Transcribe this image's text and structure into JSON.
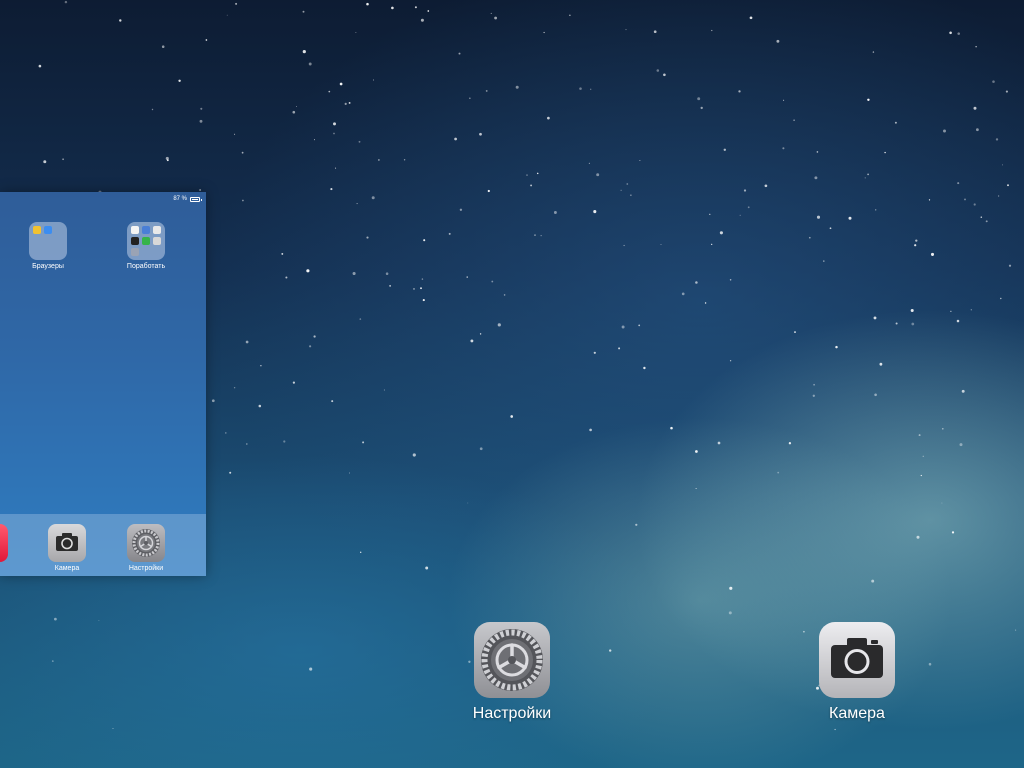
{
  "switcher_card": {
    "status": {
      "battery_text": "87 %"
    },
    "folders": [
      {
        "label": "Браузеры",
        "icon": "folder-icon"
      },
      {
        "label": "Поработать",
        "icon": "folder-icon"
      }
    ],
    "dock": [
      {
        "label": "Камера",
        "icon": "camera-icon"
      },
      {
        "label": "Настройки",
        "icon": "settings-gear-icon"
      }
    ]
  },
  "switcher_apps": [
    {
      "label": "Настройки",
      "icon": "settings-gear-icon"
    },
    {
      "label": "Камера",
      "icon": "camera-icon"
    }
  ],
  "colors": {
    "card_blue": "#2f67a6",
    "sky_top": "#0d1c33",
    "sky_bottom": "#1e6688"
  }
}
